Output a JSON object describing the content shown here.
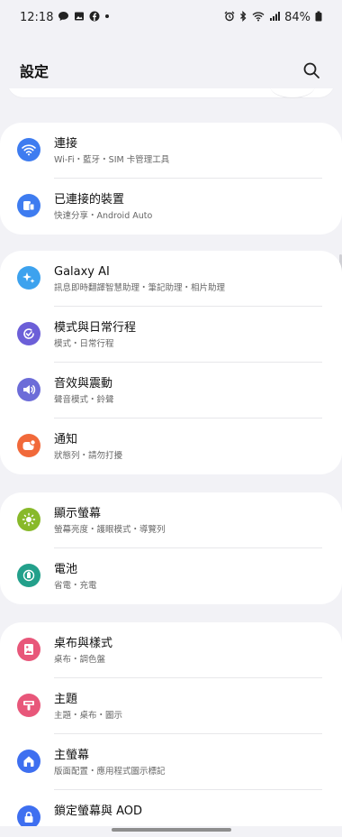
{
  "status_bar": {
    "time": "12:18",
    "battery": "84%",
    "left_icons": [
      "chat-icon",
      "image-icon",
      "facebook-icon",
      "dot-icon"
    ],
    "right_icons": [
      "alarm-icon",
      "bluetooth-icon",
      "wifi-icon",
      "signal-icon",
      "battery-icon"
    ]
  },
  "header": {
    "title": "設定",
    "search_icon": "search-icon"
  },
  "groups": [
    {
      "items": [
        {
          "title": "連接",
          "subtitle": "Wi-Fi・藍牙・SIM 卡管理工具",
          "icon": "wifi-icon",
          "color": "#3e7cf0"
        },
        {
          "title": "已連接的裝置",
          "subtitle": "快速分享・Android Auto",
          "icon": "devices-icon",
          "color": "#3e7cf0"
        }
      ]
    },
    {
      "items": [
        {
          "title": "Galaxy AI",
          "subtitle": "訊息即時翻譯智慧助理・筆記助理・相片助理",
          "icon": "sparkle-icon",
          "color": "#3da2ee"
        },
        {
          "title": "模式與日常行程",
          "subtitle": "模式・日常行程",
          "icon": "check-circle-icon",
          "color": "#6c5fd8"
        },
        {
          "title": "音效與震動",
          "subtitle": "聲音模式・鈴聲",
          "icon": "speaker-icon",
          "color": "#6c6cd8"
        },
        {
          "title": "通知",
          "subtitle": "狀態列・請勿打擾",
          "icon": "notification-icon",
          "color": "#f1693a"
        }
      ]
    },
    {
      "items": [
        {
          "title": "顯示螢幕",
          "subtitle": "螢幕亮度・護眼模式・導覽列",
          "icon": "brightness-icon",
          "color": "#88b92a"
        },
        {
          "title": "電池",
          "subtitle": "省電・充電",
          "icon": "battery-icon",
          "color": "#23a08b"
        }
      ]
    },
    {
      "items": [
        {
          "title": "桌布與樣式",
          "subtitle": "桌布・調色盤",
          "icon": "wallpaper-icon",
          "color": "#e8577a"
        },
        {
          "title": "主題",
          "subtitle": "主題・桌布・圖示",
          "icon": "theme-icon",
          "color": "#e8577a"
        },
        {
          "title": "主螢幕",
          "subtitle": "版面配置・應用程式圖示標記",
          "icon": "home-icon",
          "color": "#3e6ff0"
        },
        {
          "title": "鎖定螢幕與 AOD",
          "subtitle": "",
          "icon": "lock-icon",
          "color": "#3e6ff0"
        }
      ]
    }
  ]
}
